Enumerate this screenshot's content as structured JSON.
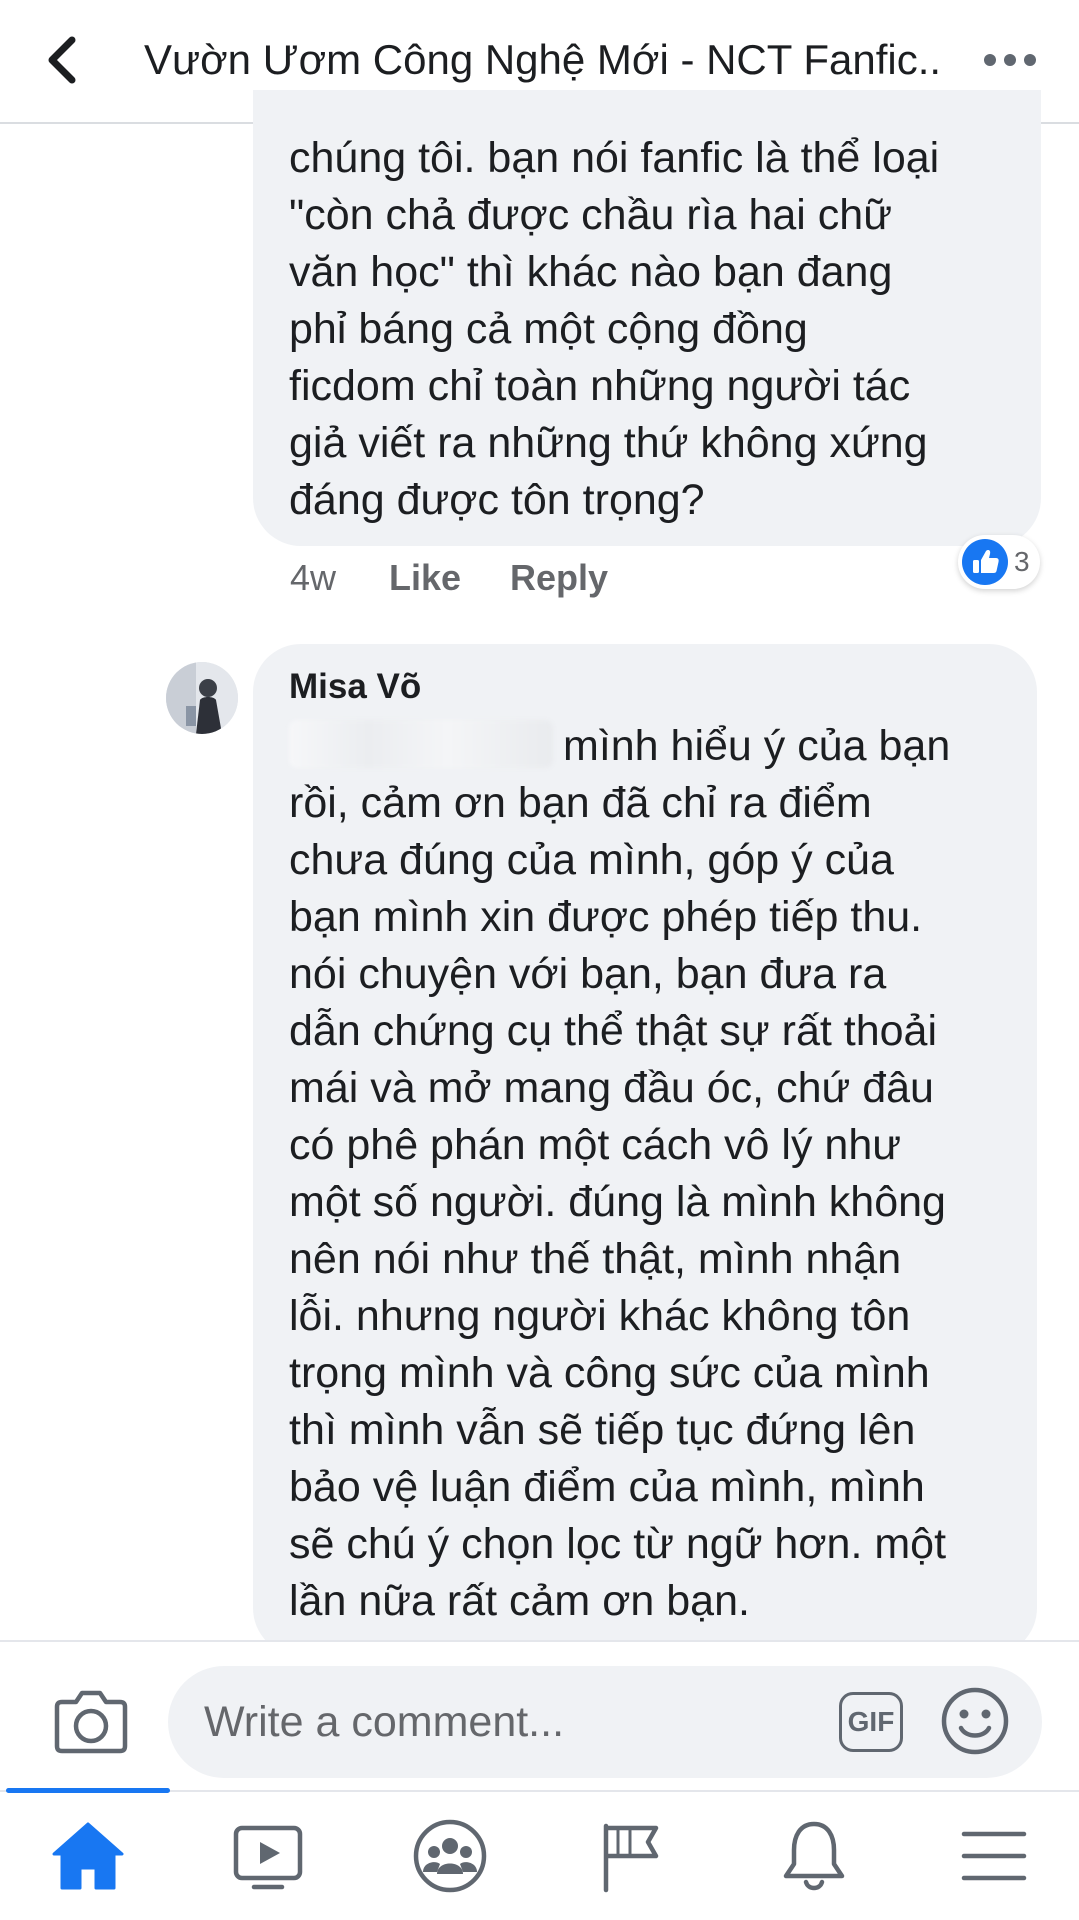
{
  "header": {
    "title": "Vườn Ươm Công Nghệ Mới - NCT Fanfic..."
  },
  "comments": [
    {
      "text": "chúng tôi. bạn nói fanfic là thể loại\n\"còn chả được chầu rìa hai chữ\nvăn học\" thì khác nào bạn đang\nphỉ báng cả một cộng đồng\nficdom chỉ toàn những người tác\ngiả viết ra những thứ không xứng\nđáng được tôn trọng?",
      "time": "4w",
      "like_label": "Like",
      "reply_label": "Reply",
      "reaction_count": "3"
    },
    {
      "author": "Misa Võ",
      "text": "mình hiểu ý của bạn\nrồi, cảm ơn bạn đã chỉ ra điểm\nchưa đúng của mình, góp ý của\nbạn mình xin được phép tiếp thu.\nnói chuyện với bạn, bạn đưa ra\ndẫn chứng cụ thể thật sự rất thoải\nmái và mở mang đầu óc, chứ đâu\ncó phê phán một cách vô lý như\nmột số người. đúng là mình không\nnên nói như thế thật, mình nhận\nlỗi. nhưng người khác không tôn\ntrọng mình và công sức của mình\nthì mình vẫn sẽ tiếp tục đứng lên\nbảo vệ luận điểm của mình, mình\nsẽ chú ý chọn lọc từ ngữ hơn. một\nlần nữa rất cảm ơn bạn."
    }
  ],
  "composer": {
    "placeholder": "Write a comment...",
    "gif_label": "GIF"
  },
  "tabs": [
    {
      "icon": "home-icon",
      "active": true
    },
    {
      "icon": "video-icon",
      "active": false
    },
    {
      "icon": "groups-icon",
      "active": false
    },
    {
      "icon": "pages-flag-icon",
      "active": false
    },
    {
      "icon": "notifications-bell-icon",
      "active": false
    },
    {
      "icon": "menu-icon",
      "active": false
    }
  ],
  "colors": {
    "accent": "#1877f2",
    "bubble": "#f0f2f5",
    "secondary_text": "#65676b",
    "icon_gray": "#606770"
  }
}
